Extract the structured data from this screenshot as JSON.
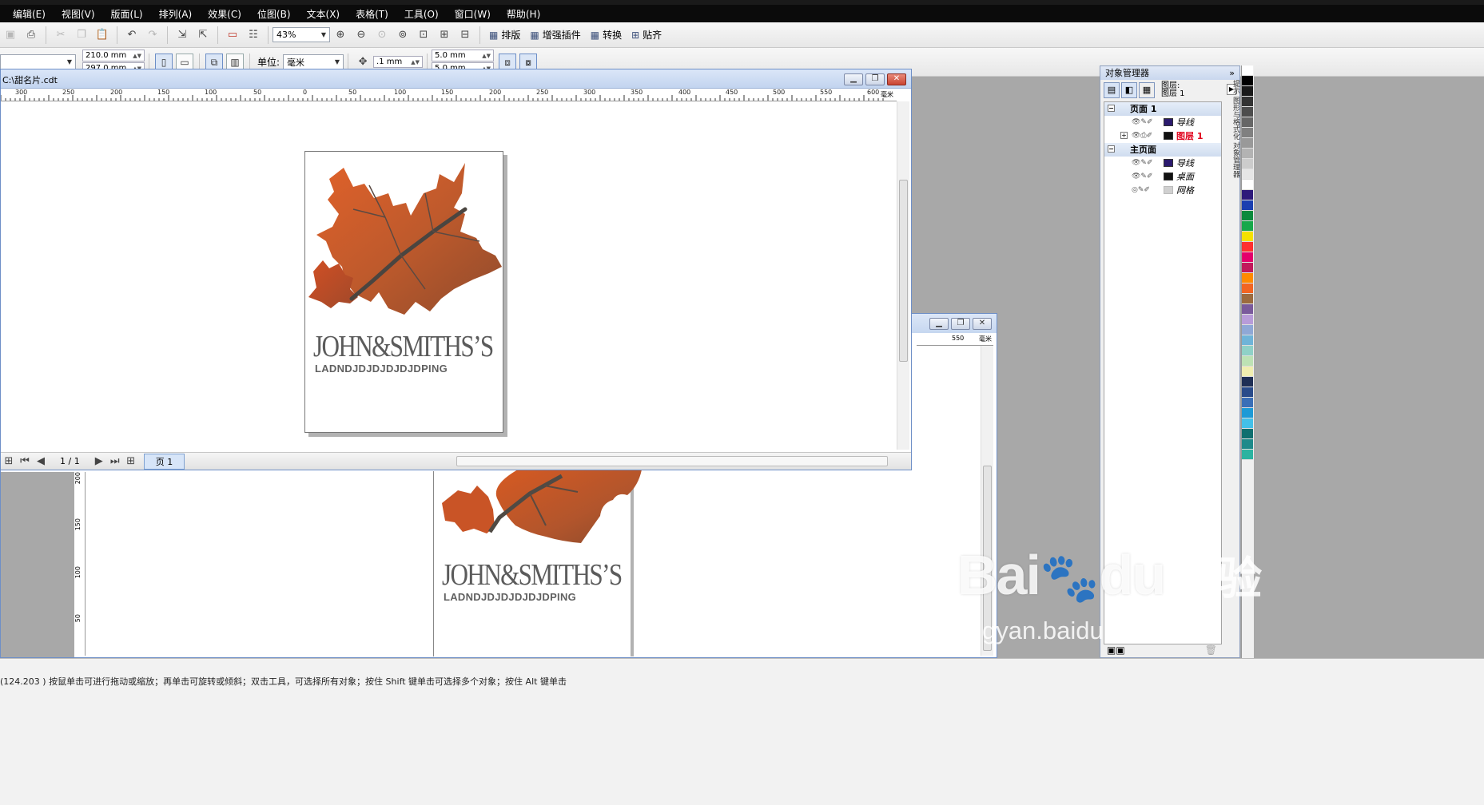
{
  "menu": [
    "编辑(E)",
    "视图(V)",
    "版面(L)",
    "排列(A)",
    "效果(C)",
    "位图(B)",
    "文本(X)",
    "表格(T)",
    "工具(O)",
    "窗口(W)",
    "帮助(H)"
  ],
  "toolbar1": {
    "zoom": "43%",
    "buttons": [
      "排版",
      "增强插件",
      "转换",
      "贴齐"
    ]
  },
  "toolbar2": {
    "width": "210.0 mm",
    "height": "297.0 mm",
    "unit_label": "单位:",
    "unit_value": "毫米",
    "nudge": ".1 mm",
    "dup_x": "5.0 mm",
    "dup_y": "5.0 mm"
  },
  "doc": {
    "title": "C:\\甜名片.cdt",
    "ruler_labels": [
      "300",
      "250",
      "200",
      "150",
      "100",
      "50",
      "0",
      "50",
      "100",
      "150",
      "200",
      "250",
      "300",
      "350",
      "400",
      "450",
      "500",
      "550",
      "600"
    ],
    "ruler_unit": "毫米",
    "page_counter": "1 / 1",
    "page_tab": "页 1"
  },
  "card": {
    "brand": "JOHN&SMITHS’S",
    "tagline": "LADNDJDJDJDJDJDPING"
  },
  "back_window": {
    "ruler_label": "550",
    "ruler_unit": "毫米",
    "left_ruler": [
      "200",
      "150",
      "100",
      "50"
    ]
  },
  "object_manager": {
    "title": "对象管理器",
    "layer_info_1": "图层:",
    "layer_info_2": "图层 1",
    "rows": [
      {
        "type": "page",
        "label": "页面 1"
      },
      {
        "type": "layer",
        "label": "导线",
        "color": "#2b1a6e"
      },
      {
        "type": "layer",
        "label": "图层 1",
        "color": "#111111",
        "active": true
      },
      {
        "type": "page",
        "label": "主页面"
      },
      {
        "type": "layer",
        "label": "导线",
        "color": "#2b1a6e"
      },
      {
        "type": "layer",
        "label": "桌面",
        "color": "#111111"
      },
      {
        "type": "layer",
        "label": "网格",
        "color": "#d0d0d0"
      }
    ],
    "side_tabs": "提示 图形与格式化 对象管理器"
  },
  "palette": [
    "#ffffff",
    "#000000",
    "#1a1a1a",
    "#333333",
    "#4d4d4d",
    "#666666",
    "#808080",
    "#999999",
    "#b3b3b3",
    "#cccccc",
    "#e6e6e6",
    "#ffffff",
    "#2e1a7a",
    "#1a3fb0",
    "#0b8a3c",
    "#17a84a",
    "#f5e100",
    "#ff2f2f",
    "#e4006b",
    "#c2185b",
    "#ff8a00",
    "#f26522",
    "#9c6b3f",
    "#7a5a9c",
    "#b89cd9",
    "#8fa8d6",
    "#6fb4d8",
    "#8fd1c7",
    "#bde2b4",
    "#f0eeb0",
    "#1f2f55",
    "#294b8a",
    "#3a6fb7",
    "#1d9ad6",
    "#43c0e8",
    "#0f6f6f",
    "#1e8a8a",
    "#2bb3a0"
  ],
  "status": {
    "text": "(124.203 )    按鼠单击可进行拖动或缩放；再单击可旋转或倾斜；双击工具，可选择所有对象；按住 Shift 键单击可选择多个对象；按住 Alt 键单击"
  },
  "watermark": {
    "brand": "Bai",
    "brand2": "du",
    "cn": "经验",
    "url": "jingyan.baidu.com"
  }
}
